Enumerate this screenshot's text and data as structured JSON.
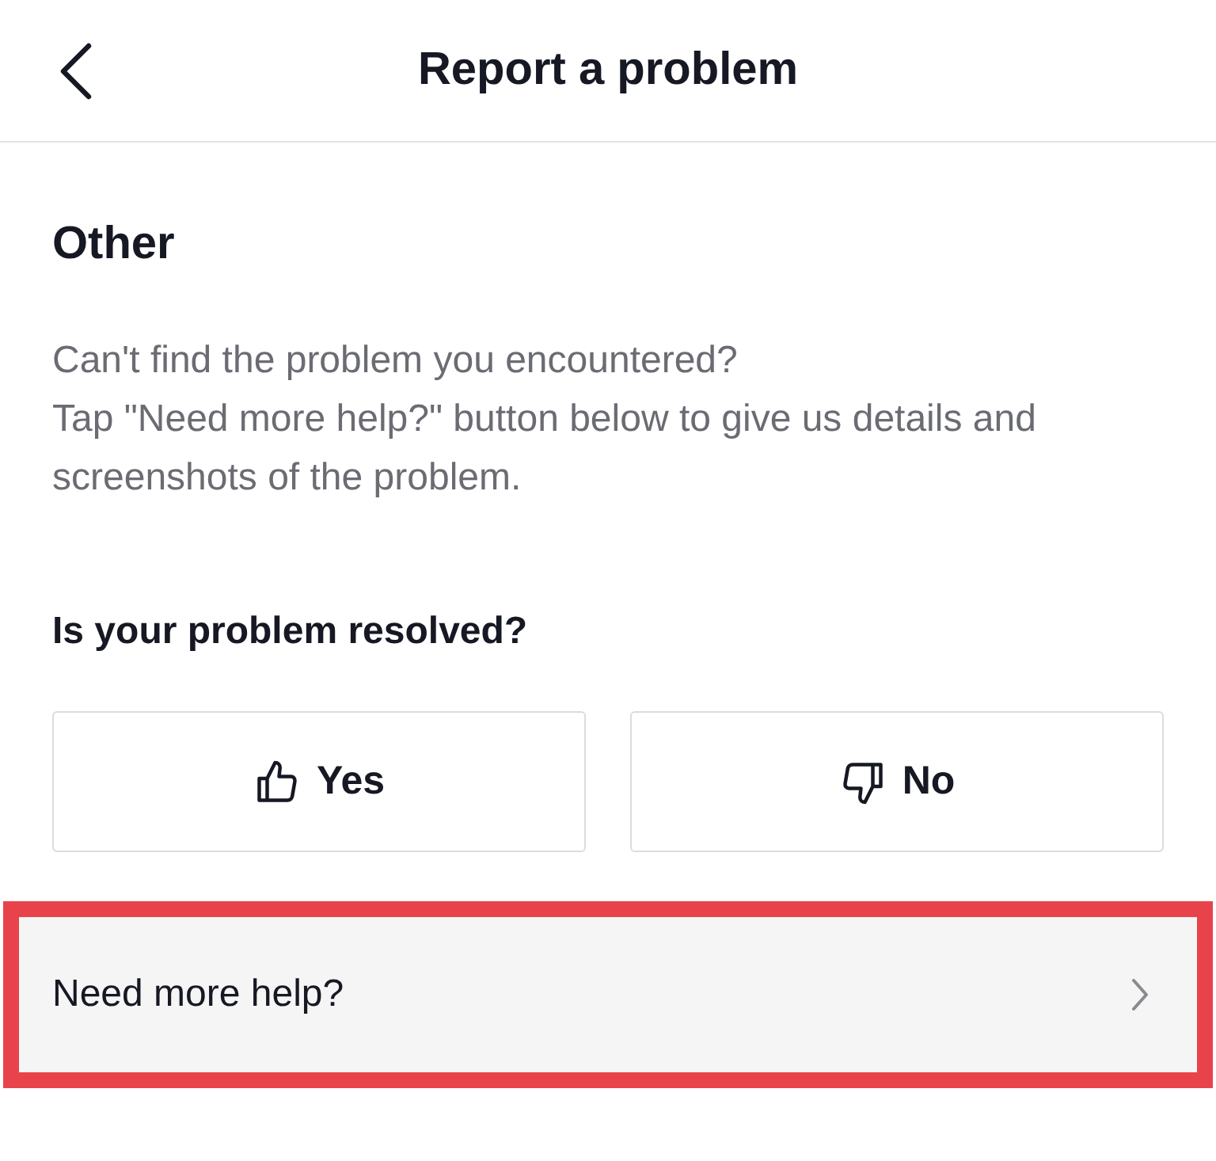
{
  "header": {
    "title": "Report a problem"
  },
  "section": {
    "title": "Other",
    "description": [
      "Can't find the problem you encountered?",
      "Tap \"Need more help?\" button below to give us details and screenshots of the problem."
    ]
  },
  "feedback": {
    "question": "Is your problem resolved?",
    "options": [
      {
        "label": "Yes",
        "kind": "up"
      },
      {
        "label": "No",
        "kind": "down"
      }
    ]
  },
  "help_row": {
    "label": "Need more help?",
    "highlighted": true
  }
}
